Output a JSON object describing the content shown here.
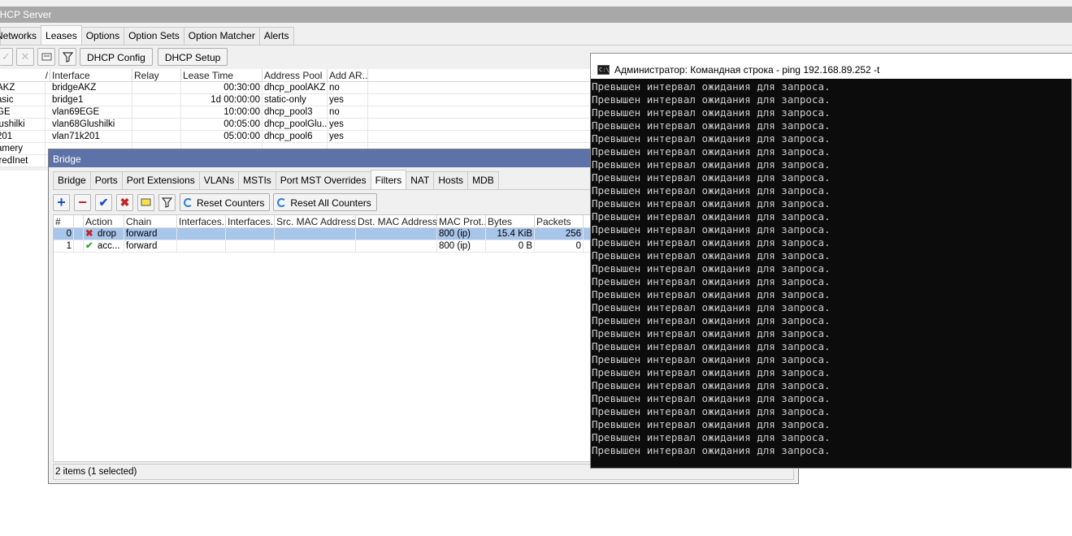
{
  "dhcp_window": {
    "title": "DHCP Server",
    "tabs": [
      "Networks",
      "Leases",
      "Options",
      "Option Sets",
      "Option Matcher",
      "Alerts"
    ],
    "toolbar": {
      "config_label": "DHCP Config",
      "setup_label": "DHCP Setup"
    },
    "sort_marker": "/",
    "columns": [
      "Interface",
      "Relay",
      "Lease Time",
      "Address Pool",
      "Add AR..."
    ],
    "rows": [
      {
        "name": "AKZ",
        "interface": "bridgeAKZ",
        "relay": "",
        "lease_time": "00:30:00",
        "address_pool": "dhcp_poolAKZ",
        "add_arp": "no"
      },
      {
        "name": "asic",
        "interface": "bridge1",
        "relay": "",
        "lease_time": "1d 00:00:00",
        "address_pool": "static-only",
        "add_arp": "yes"
      },
      {
        "name": "GE",
        "interface": "vlan69EGE",
        "relay": "",
        "lease_time": "10:00:00",
        "address_pool": "dhcp_pool3",
        "add_arp": "no"
      },
      {
        "name": "lushilki",
        "interface": "vlan68Glushilki",
        "relay": "",
        "lease_time": "00:05:00",
        "address_pool": "dhcp_poolGlu...",
        "add_arp": "yes"
      },
      {
        "name": "201",
        "interface": "vlan71k201",
        "relay": "",
        "lease_time": "05:00:00",
        "address_pool": "dhcp_pool6",
        "add_arp": "yes"
      },
      {
        "name": "amery",
        "interface": "",
        "relay": "",
        "lease_time": "",
        "address_pool": "",
        "add_arp": ""
      },
      {
        "name": "iredInet",
        "interface": "",
        "relay": "",
        "lease_time": "",
        "address_pool": "",
        "add_arp": ""
      }
    ]
  },
  "bridge_window": {
    "title": "Bridge",
    "tabs": [
      "Bridge",
      "Ports",
      "Port Extensions",
      "VLANs",
      "MSTIs",
      "Port MST Overrides",
      "Filters",
      "NAT",
      "Hosts",
      "MDB"
    ],
    "active_tab": "Filters",
    "toolbar": {
      "reset_counters": "Reset Counters",
      "reset_all_counters": "Reset All Counters"
    },
    "columns": [
      "#",
      "Action",
      "Chain",
      "Interfaces...",
      "Interfaces...",
      "Src. MAC Address...",
      "Dst. MAC Address...",
      "MAC Prot...",
      "Bytes",
      "Packets"
    ],
    "rows": [
      {
        "num": "0",
        "action": "drop",
        "action_icon": "red-x-icon",
        "chain": "forward",
        "mac_protocol": "800 (ip)",
        "bytes": "15.4 KiB",
        "packets": "256",
        "selected": true
      },
      {
        "num": "1",
        "action": "acc...",
        "action_icon": "green-check-icon",
        "chain": "forward",
        "mac_protocol": "800 (ip)",
        "bytes": "0 B",
        "packets": "0",
        "selected": false
      }
    ],
    "status": "2 items (1 selected)"
  },
  "console_window": {
    "title": "Администратор: Командная строка - ping  192.168.89.252 -t",
    "line_text": "Превышен интервал ожидания для запроса.",
    "line_count": 29
  },
  "colors": {
    "bridge_title_bg": "#5d72a8",
    "selection": "#a8c5ea",
    "console_bg": "#0c0c0c",
    "console_fg": "#cccccc"
  }
}
